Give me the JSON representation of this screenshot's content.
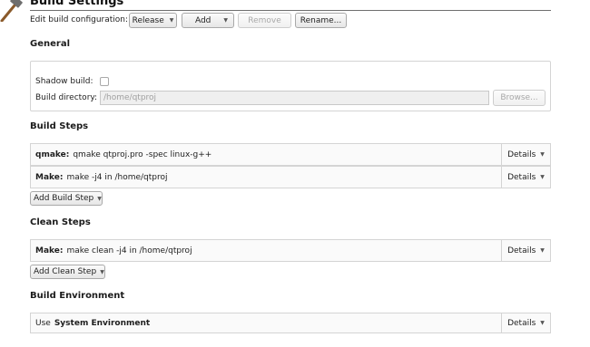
{
  "header": {
    "title": "Build Settings"
  },
  "config_bar": {
    "label": "Edit build configuration:",
    "configuration_selected": "Release",
    "add_label": "Add",
    "remove_label": "Remove",
    "rename_label": "Rename..."
  },
  "general": {
    "title": "General",
    "shadow_build_label": "Shadow build:",
    "shadow_build_checked": false,
    "build_directory_label": "Build directory:",
    "build_directory_value": "/home/qtproj",
    "browse_label": "Browse..."
  },
  "build_steps": {
    "title": "Build Steps",
    "steps": [
      {
        "name": "qmake:",
        "command": "qmake qtproj.pro -spec linux-g++",
        "details_label": "Details"
      },
      {
        "name": "Make:",
        "command": "make -j4 in /home/qtproj",
        "details_label": "Details"
      }
    ],
    "add_label": "Add Build Step"
  },
  "clean_steps": {
    "title": "Clean Steps",
    "steps": [
      {
        "name": "Make:",
        "command": "make clean -j4 in /home/qtproj",
        "details_label": "Details"
      }
    ],
    "add_label": "Add Clean Step"
  },
  "build_environment": {
    "title": "Build Environment",
    "prefix": "Use",
    "value": "System Environment",
    "details_label": "Details"
  }
}
